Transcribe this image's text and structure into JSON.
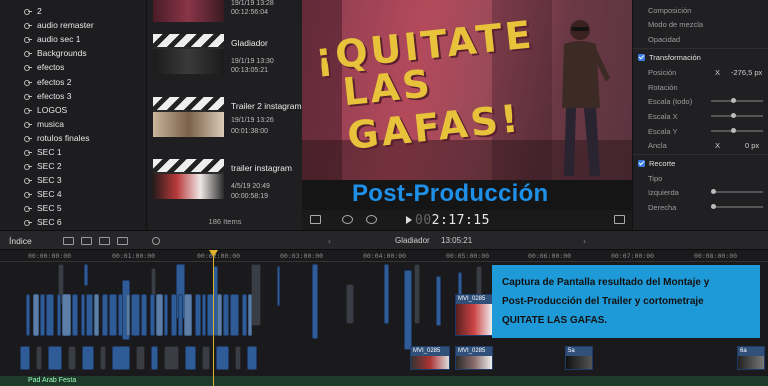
{
  "sidebar": {
    "keywords": [
      "2",
      "audio remaster",
      "audio sec 1",
      "Backgrounds",
      "efectos",
      "efectos 2",
      "efectos 3",
      "LOGOS",
      "musica",
      "rotulos finales",
      "SEC 1",
      "SEC 2",
      "SEC 3",
      "SEC 4",
      "SEC 5",
      "SEC 6"
    ]
  },
  "browser": {
    "clips": [
      {
        "name": "",
        "date": "",
        "time": "00:12:56:04"
      },
      {
        "name": "Gladiador",
        "date": "19/1/19 13:30",
        "time": "00:13:05:21"
      },
      {
        "name": "Trailer 2 instagram",
        "date": "19/1/19 13:26",
        "time": "00:01:38:00"
      },
      {
        "name": "trailer instagram",
        "date": "4/5/19 20:49",
        "time": "00:00:58:19"
      }
    ],
    "partial_date": "19/1/19 13:28",
    "items_count": "186 Items"
  },
  "viewer": {
    "title_art_line1": "¡QUITATE",
    "title_art_line2": "LAS GAFAS!",
    "overlay_title": "Post-Producción",
    "timecode_dim": "00",
    "timecode": "2:17:15"
  },
  "inspector": {
    "composicion": "Composición",
    "modo_mezcla": "Modo de mezcla",
    "opacidad": "Opacidad",
    "transformacion": "Transformación",
    "posicion": "Posición",
    "posicion_x_label": "X",
    "posicion_x_value": "-276,5 px",
    "rotacion": "Rotación",
    "escala_todo": "Escala (todo)",
    "escala_x": "Escala X",
    "escala_y": "Escala Y",
    "ancla": "Ancla",
    "ancla_x_label": "X",
    "ancla_x_value": "0 px",
    "recorte": "Recorte",
    "tipo": "Tipo",
    "izquierda": "Izquierda",
    "derecha": "Derecha"
  },
  "toolbar": {
    "index_label": "Índice",
    "project_name": "Gladiador",
    "project_duration": "13:05:21"
  },
  "timeline": {
    "ruler_ticks": [
      "00:00:00:00",
      "00:01:00:00",
      "00:02:00:00",
      "00:03:00:00",
      "00:04:00:00",
      "00:05:00:00",
      "00:06:00:00",
      "00:07:00:00",
      "00:08:00:00"
    ],
    "clip_titles": [
      "MVI_0285",
      "MVI_0285",
      "MVI_0285",
      "5a",
      "6a"
    ],
    "audio_label": "Pad Arab Festa"
  },
  "caption": {
    "line1": "Captura de Pantalla resultado del Montaje y",
    "line2": "Post-Producción del Trailer y cortometraje",
    "line3": "QUITATE LAS GAFAS."
  },
  "colors": {
    "accent_blue": "#1f9ad8",
    "overlay_blue": "#1e90e8",
    "title_yellow": "#e8c23a",
    "clip_blue": "#2f5c96",
    "playhead": "#e0b32a"
  }
}
